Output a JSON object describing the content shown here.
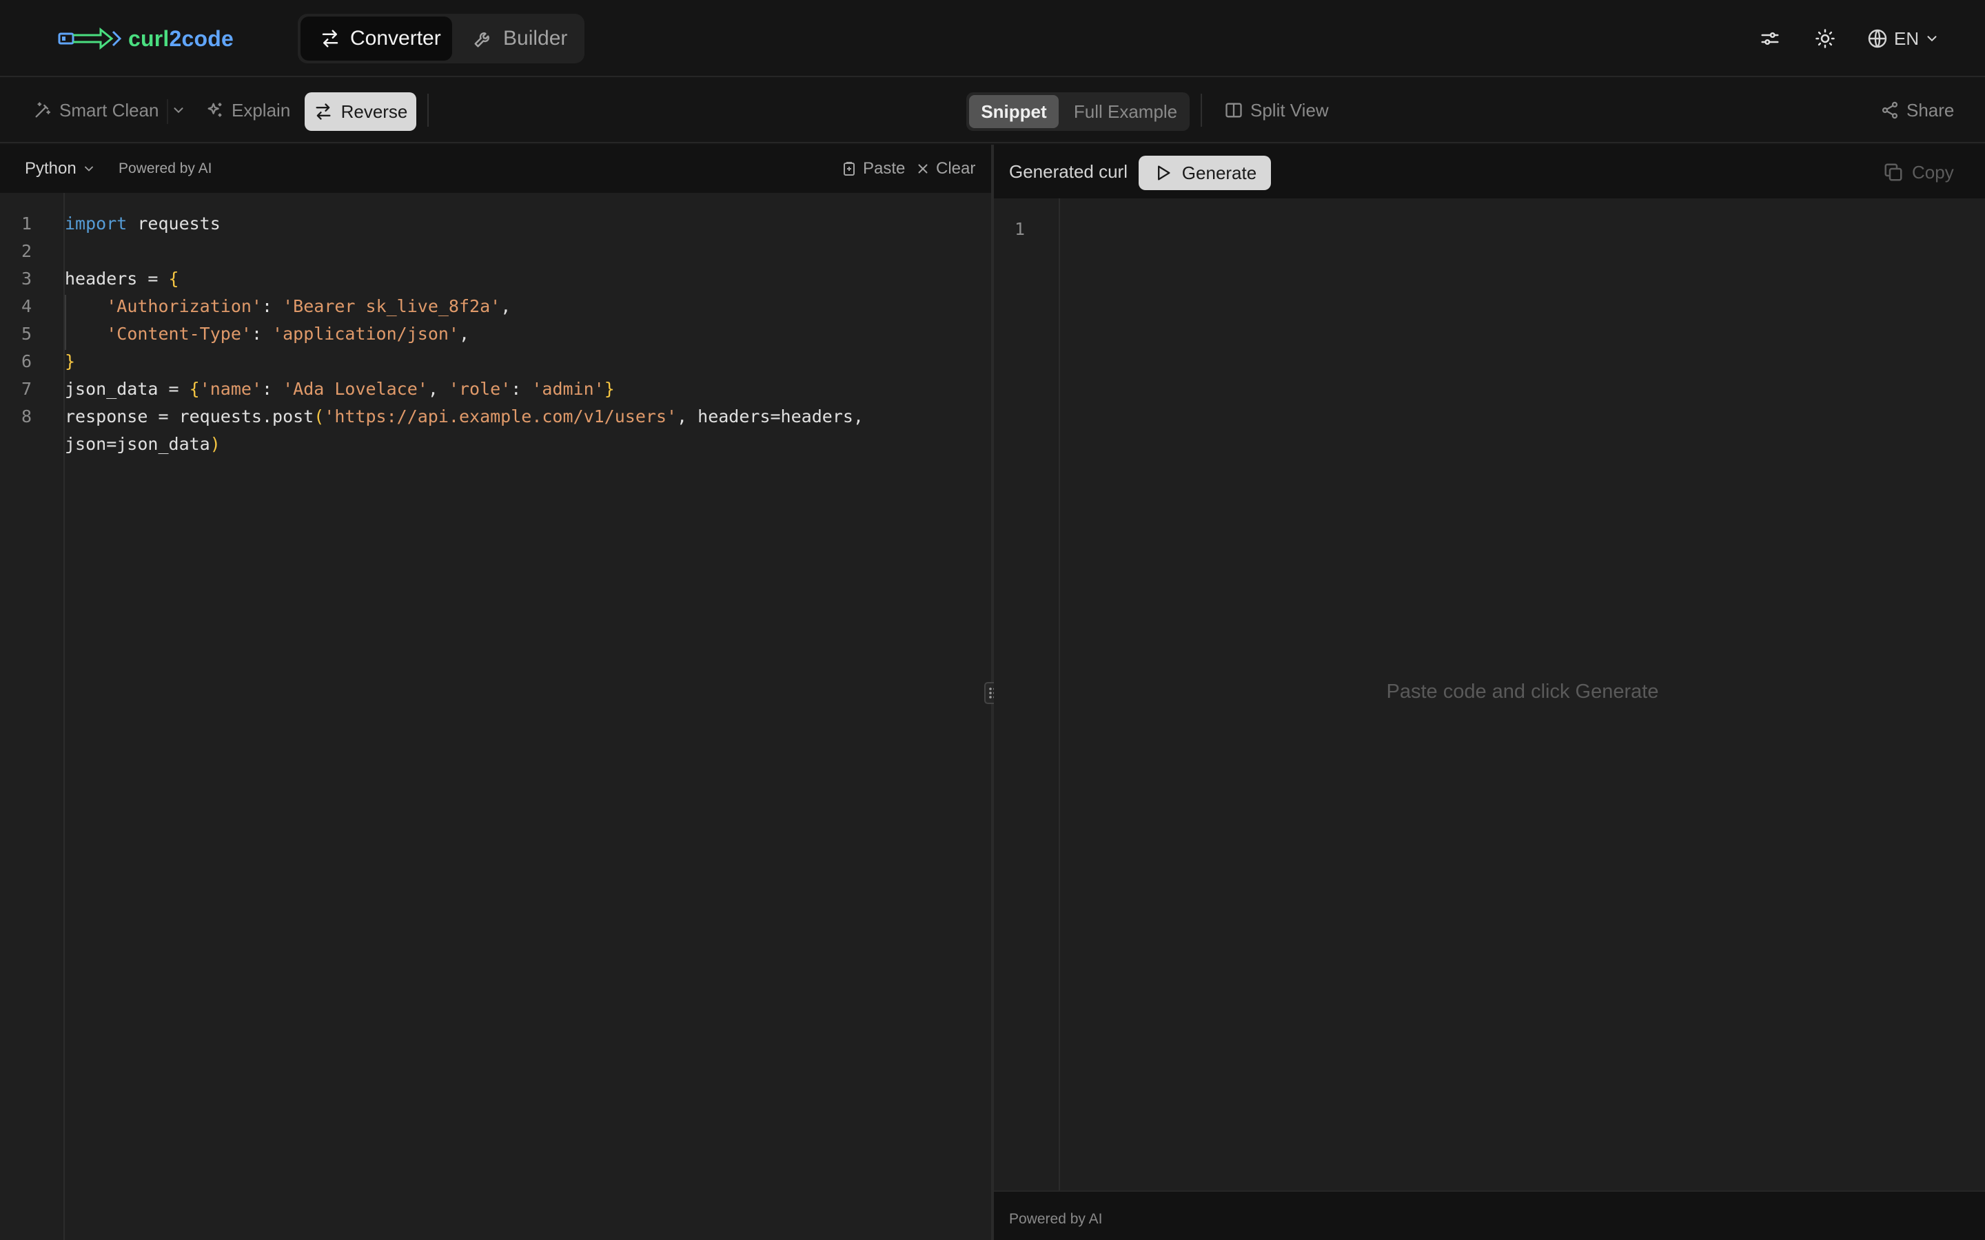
{
  "app": {
    "logo_part1": "curl",
    "logo_part2": "2code"
  },
  "header": {
    "modes": [
      {
        "label": "Converter",
        "icon": "arrows-swap-icon",
        "active": true
      },
      {
        "label": "Builder",
        "icon": "wrench-icon",
        "active": false
      }
    ],
    "language": "EN"
  },
  "toolbar": {
    "smart_clean": "Smart Clean",
    "explain": "Explain",
    "reverse": "Reverse",
    "view_options": [
      "Snippet",
      "Full Example"
    ],
    "selected_view": "Snippet",
    "split_view": "Split View",
    "share": "Share"
  },
  "left_pane": {
    "language": "Python",
    "powered_by": "Powered by AI",
    "paste": "Paste",
    "clear": "Clear",
    "line_numbers": [
      "1",
      "2",
      "3",
      "4",
      "5",
      "6",
      "7",
      "8"
    ],
    "code": [
      "import requests",
      "",
      "headers = {",
      "    'Authorization': 'Bearer sk_live_8f2a',",
      "    'Content-Type': 'application/json',",
      "}",
      "json_data = {'name': 'Ada Lovelace', 'role': 'admin'}",
      "response = requests.post('https://api.example.com/v1/users', headers=headers,",
      "json=json_data)"
    ]
  },
  "right_pane": {
    "label": "Generated curl",
    "generate": "Generate",
    "copy": "Copy",
    "line_number": "1",
    "empty_message": "Paste code and click Generate",
    "footer": "Powered by AI"
  },
  "colors": {
    "keyword": "#569cd6",
    "string": "#e09a6a",
    "bracket": "#f5c542",
    "logo_green": "#4ade80",
    "logo_blue": "#60a5fa"
  }
}
